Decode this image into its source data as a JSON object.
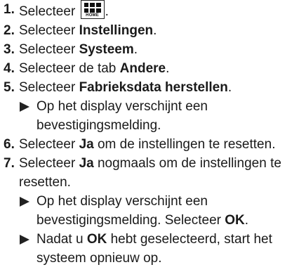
{
  "steps": [
    {
      "number": "1.",
      "text": "Selecteer",
      "icon_label": "HOME",
      "after_icon": "."
    },
    {
      "number": "2.",
      "text": "Selecteer",
      "bold": "Instellingen",
      "after": "."
    },
    {
      "number": "3.",
      "text": "Selecteer",
      "bold": "Systeem",
      "after": "."
    },
    {
      "number": "4.",
      "text": "Selecteer de tab",
      "bold": "Andere",
      "after": "."
    },
    {
      "number": "5.",
      "text": "Selecteer",
      "bold": "Fabrieksdata herstellen",
      "after": ".",
      "results": [
        "Op het display verschijnt een bevestigingsmelding."
      ]
    },
    {
      "number": "6.",
      "text": "Selecteer",
      "bold": "Ja",
      "after": "om de instellingen te resetten."
    },
    {
      "number": "7.",
      "text": "Selecteer",
      "bold": "Ja",
      "after": "nogmaals om de instellingen te resetten.",
      "results": [
        {
          "before": "Op het display verschijnt een bevestigingsmelding. Selecteer",
          "bold": "OK",
          "after": "."
        },
        {
          "before": "Nadat u",
          "bold": "OK",
          "after": "hebt geselecteerd, start het systeem opnieuw op."
        }
      ]
    }
  ],
  "icons": {
    "home": "home-icon",
    "result_arrow": "triangle-right-icon"
  }
}
